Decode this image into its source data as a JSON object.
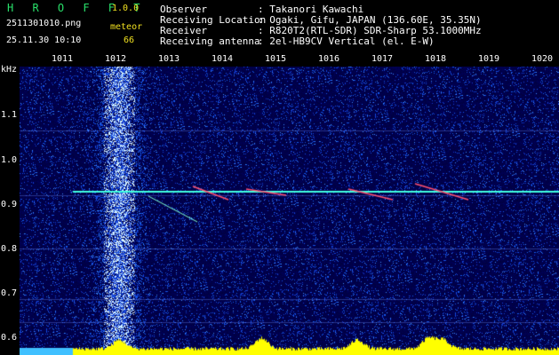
{
  "header": {
    "app_name": "H R O F F T",
    "version": "1.0.0",
    "filename": "2511301010.png",
    "detection_label": "meteor",
    "datetime": "25.11.30 10:10",
    "meteor_count": "66",
    "info": [
      {
        "key": "Observer",
        "value": ": Takanori Kawachi"
      },
      {
        "key": "Receiving Location",
        "value": ": Ogaki, Gifu, JAPAN (136.60E, 35.35N)"
      },
      {
        "key": "Receiver",
        "value": ": R820T2(RTL-SDR) SDR-Sharp 53.1000MHz"
      },
      {
        "key": "Receiving antenna",
        "value": ": 2el-HB9CV Vertical (el. E-W)"
      }
    ]
  },
  "axes": {
    "y_unit": "kHz",
    "y_ticks": [
      "1.1",
      "1.0",
      "0.9",
      "0.8",
      "0.7",
      "0.6"
    ],
    "x_ticks": [
      "1011",
      "1012",
      "1013",
      "1014",
      "1015",
      "1016",
      "1017",
      "1018",
      "1019",
      "1020"
    ]
  },
  "colors": {
    "background": "#00004a",
    "noise": "#1a3cff",
    "carrier": "#40ffe0",
    "histogram": "#ffff00",
    "label_yellow": "#f0e020"
  }
}
